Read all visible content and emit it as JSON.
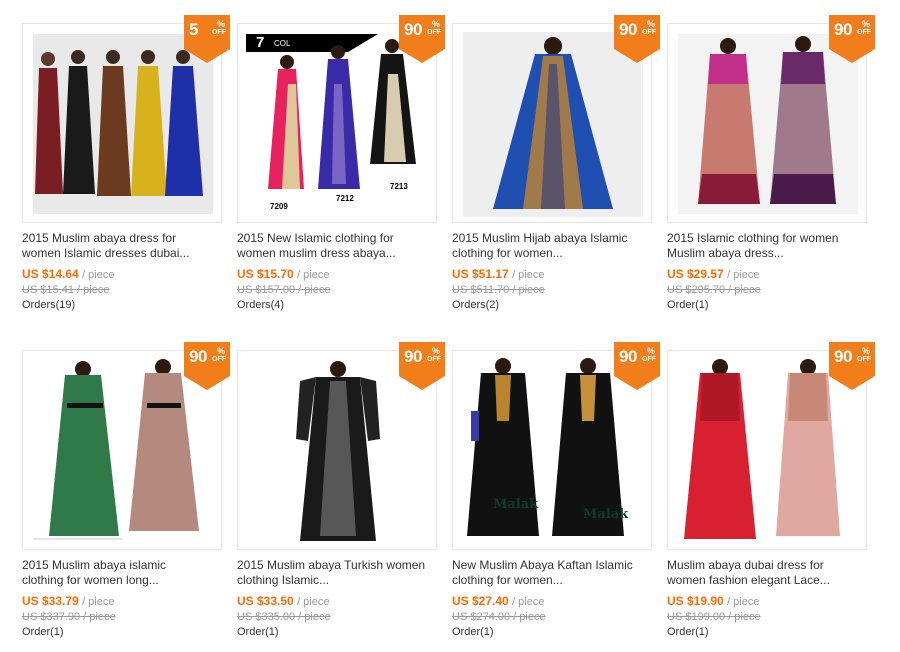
{
  "colors": {
    "accent": "#ff6a00",
    "badge": "#f27d1b",
    "muted": "#999999",
    "text": "#333333"
  },
  "products": [
    {
      "discount": "5",
      "title1": "2015 Muslim abaya dress for",
      "title2": "women Islamic dresses dubai...",
      "price": "US $14.64",
      "unit": "/ piece",
      "old": "US $15.41 / piece",
      "orders": "Orders(19)"
    },
    {
      "discount": "90",
      "title1": "2015 New Islamic clothing for",
      "title2": "women muslim dress abaya...",
      "price": "US $15.70",
      "unit": "/ piece",
      "old": "US $157.00 / piece",
      "orders": "Orders(4)",
      "tag": "7",
      "tag_small": "COL",
      "codes": [
        "7209",
        "7212",
        "7213"
      ]
    },
    {
      "discount": "90",
      "title1": "2015 Muslim Hijab abaya Islamic",
      "title2": "clothing for women...",
      "price": "US $51.17",
      "unit": "/ piece",
      "old": "US $511.70 / piece",
      "orders": "Orders(2)"
    },
    {
      "discount": "90",
      "title1": "2015 Islamic clothing for women",
      "title2": "Muslim abaya dress...",
      "price": "US $29.57",
      "unit": "/ piece",
      "old": "US $295.70 / piece",
      "orders": "Order(1)"
    },
    {
      "discount": "90",
      "title1": "2015 Muslim abaya islamic",
      "title2": "clothing for women long...",
      "price": "US $33.79",
      "unit": "/ piece",
      "old": "US $337.90 / piece",
      "orders": "Order(1)"
    },
    {
      "discount": "90",
      "title1": "2015 Muslim abaya Turkish women",
      "title2": "clothing Islamic...",
      "price": "US $33.50",
      "unit": "/ piece",
      "old": "US $335.00 / piece",
      "orders": "Order(1)"
    },
    {
      "discount": "90",
      "title1": "New Muslim Abaya Kaftan Islamic",
      "title2": "clothing for women...",
      "price": "US $27.40",
      "unit": "/ piece",
      "old": "US $274.00 / piece",
      "orders": "Order(1)",
      "brand": "Malak"
    },
    {
      "discount": "90",
      "title1": "Muslim abaya dubai dress for",
      "title2": "women fashion elegant Lace...",
      "price": "US $19.90",
      "unit": "/ piece",
      "old": "US $199.00 / piece",
      "orders": "Order(1)"
    }
  ],
  "badge_pct": "%",
  "badge_off": "OFF"
}
